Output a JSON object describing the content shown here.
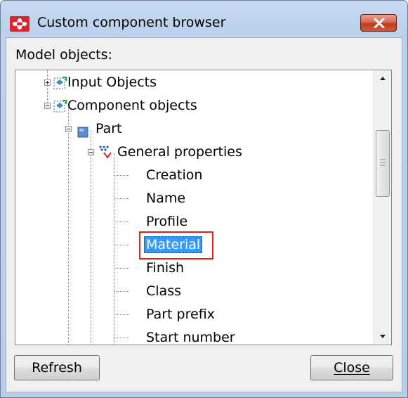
{
  "window": {
    "title": "Custom component browser",
    "icon": "tekla-component-icon",
    "close_icon": "close-icon",
    "close_color": "#c7402a"
  },
  "model_objects_label": "Model objects:",
  "tree": {
    "items": [
      {
        "label": "Input Objects",
        "icon": "objects-icon",
        "expander": "plus"
      },
      {
        "label": "Component objects",
        "icon": "objects-icon",
        "expander": "minus"
      },
      {
        "label": "Part",
        "icon": "part-icon",
        "expander": "minus"
      },
      {
        "label": "General properties",
        "icon": "properties-icon",
        "expander": "minus"
      },
      {
        "label": "Creation"
      },
      {
        "label": "Name"
      },
      {
        "label": "Profile"
      },
      {
        "label": "Material",
        "selected": true
      },
      {
        "label": "Finish"
      },
      {
        "label": "Class"
      },
      {
        "label": "Part prefix"
      },
      {
        "label": "Start number"
      }
    ]
  },
  "buttons": {
    "refresh": "Refresh",
    "close": "Close"
  },
  "colors": {
    "selection": "#3399ff",
    "highlight_box": "#e0211a"
  }
}
